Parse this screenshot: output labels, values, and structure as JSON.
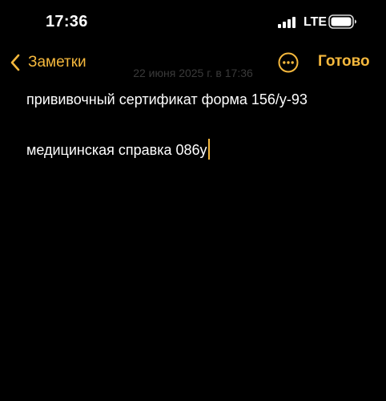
{
  "status_bar": {
    "time": "17:36",
    "network": "LTE",
    "signal_icon": "cellular-signal-icon",
    "battery_icon": "battery-icon"
  },
  "nav": {
    "back_label": "Заметки",
    "back_icon": "chevron-left-icon",
    "date_text": "22 июня 2025 г. в 17:36",
    "more_icon": "ellipsis-circle-icon",
    "done_label": "Готово"
  },
  "note": {
    "lines": [
      "прививочный сертификат форма 156/у-93",
      "медицинская справка 086у"
    ]
  },
  "colors": {
    "accent": "#f5b83d",
    "background": "#000000",
    "text": "#ffffff"
  }
}
